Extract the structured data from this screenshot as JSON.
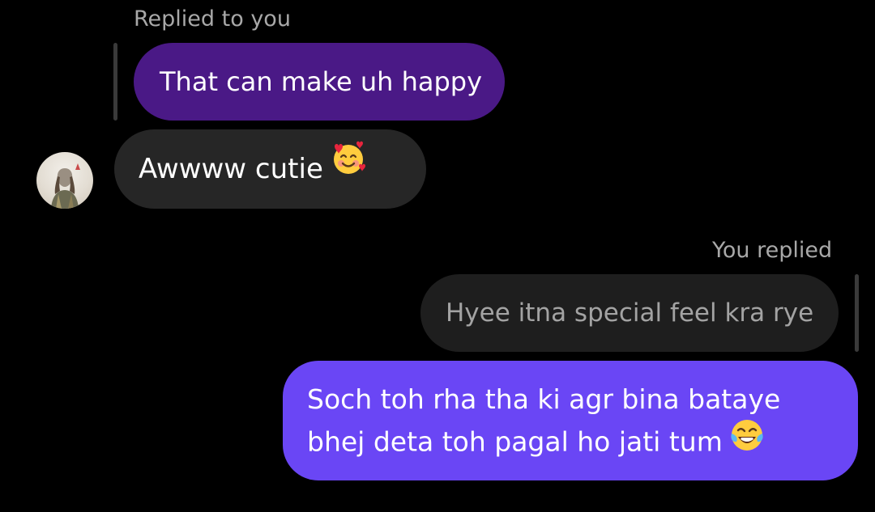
{
  "thread": {
    "reply_label_top": "Replied to you",
    "quoted_message_top": "That can make uh happy",
    "received_message": "Awwww cutie",
    "received_emoji_icon": "smiling-face-with-hearts-icon",
    "reply_label_bottom": "You replied",
    "quoted_message_bottom": "Hyee itna special feel kra rye",
    "sent_message_line1": "Soch toh rha tha ki agr bina bataye",
    "sent_message_line2": "bhej deta toh pagal ho jati tum",
    "sent_emoji_icon": "face-with-tears-of-joy-icon",
    "avatar_icon": "contact-avatar"
  },
  "colors": {
    "background": "#000000",
    "quoted_in_bubble": "#4a1986",
    "received_bubble": "#262626",
    "quoted_out_bubble": "#1e1e1e",
    "sent_bubble": "#6a46f5",
    "label_text": "#a8a8a8"
  }
}
